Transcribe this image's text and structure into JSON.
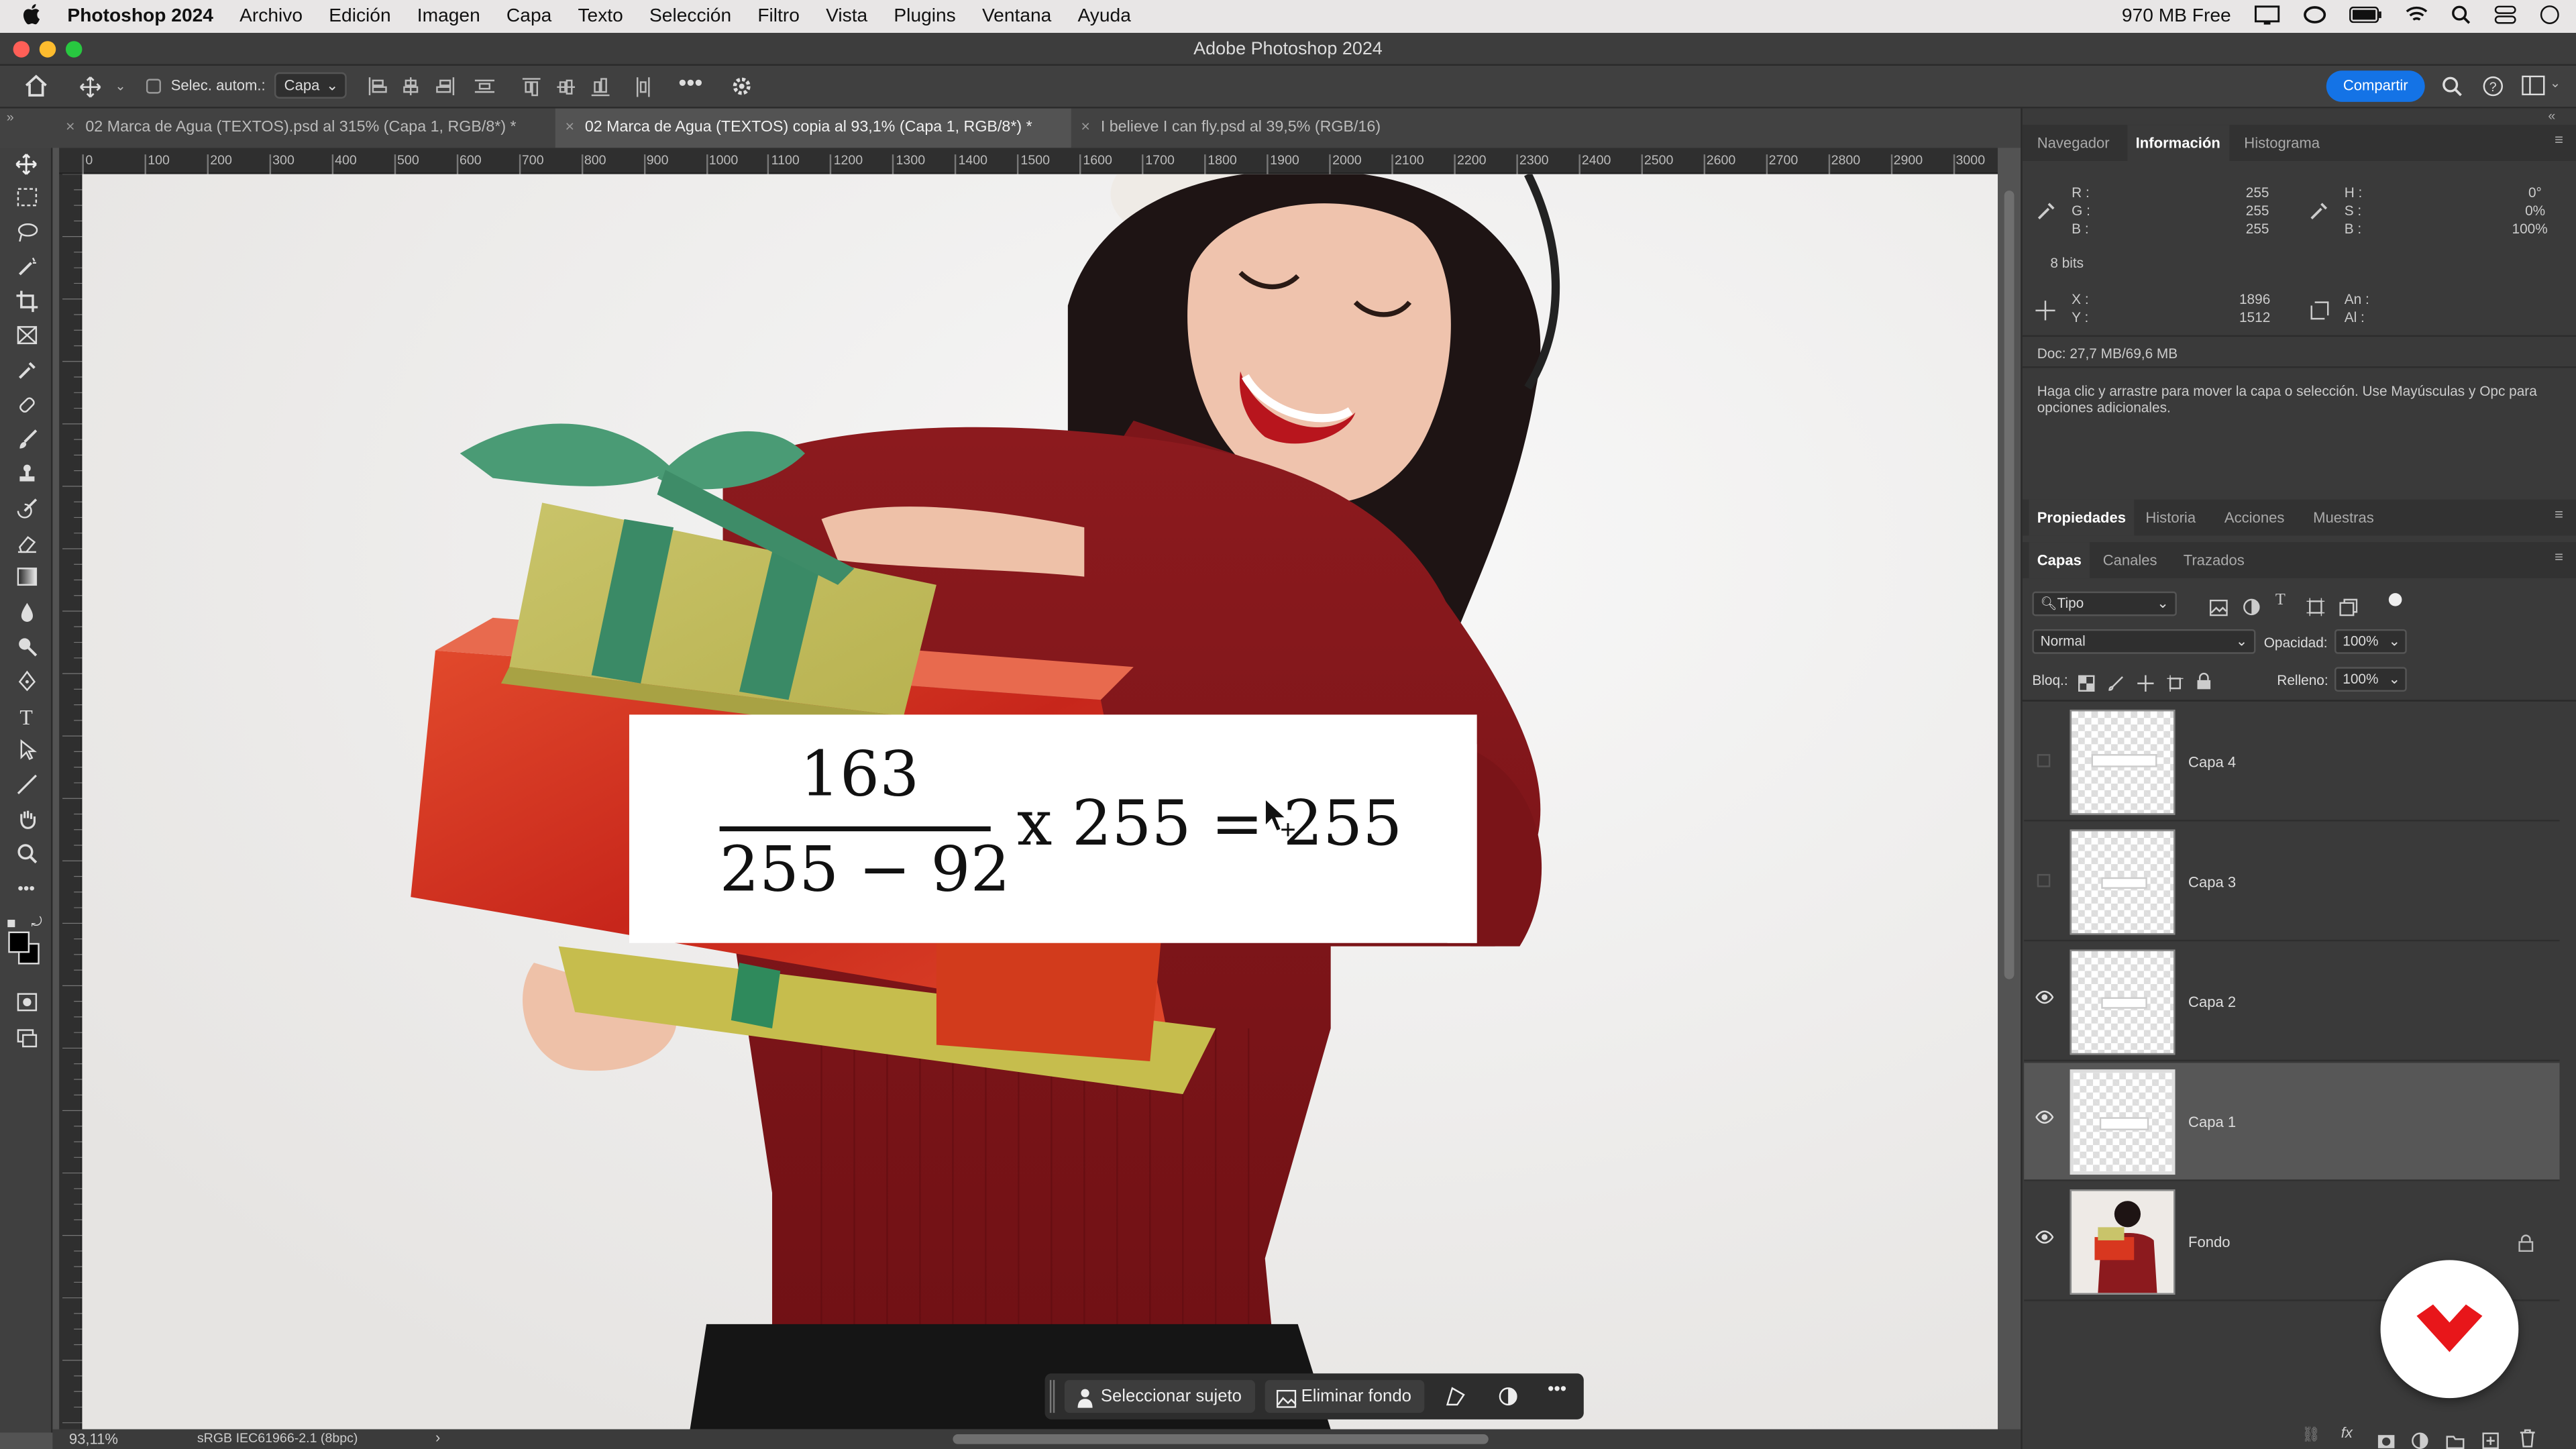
{
  "menubar": {
    "app": "Photoshop 2024",
    "items": [
      "Archivo",
      "Edición",
      "Imagen",
      "Capa",
      "Texto",
      "Selección",
      "Filtro",
      "Vista",
      "Plugins",
      "Ventana",
      "Ayuda"
    ],
    "memory": "970 MB Free"
  },
  "window": {
    "title": "Adobe Photoshop 2024"
  },
  "options": {
    "auto_select_label": "Selec. autom.:",
    "auto_select_value": "Capa",
    "share_button": "Compartir"
  },
  "tabs": [
    {
      "label": "02 Marca de Agua (TEXTOS).psd al 315% (Capa 1, RGB/8*) *"
    },
    {
      "label": "02 Marca de Agua (TEXTOS) copia al 93,1% (Capa 1, RGB/8*) *"
    },
    {
      "label": "I believe I can fly.psd al 39,5% (RGB/16)"
    }
  ],
  "ruler": {
    "ticks": [
      "0",
      "100",
      "200",
      "300",
      "400",
      "500",
      "600",
      "700",
      "800",
      "900",
      "1000",
      "1100",
      "1200",
      "1300",
      "1400",
      "1500",
      "1600",
      "1700",
      "1800",
      "1900",
      "2000",
      "2100",
      "2200",
      "2300",
      "2400",
      "2500",
      "2600",
      "2700",
      "2800",
      "2900",
      "3000"
    ]
  },
  "canvas": {
    "formula": {
      "numerator": "163",
      "denominator": "255 − 92",
      "rest": "x 255 = 255"
    }
  },
  "status": {
    "zoom": "93,11%",
    "profile": "sRGB IEC61966-2.1 (8bpc)",
    "arrow": "›"
  },
  "context_bar": {
    "select_subject": "Seleccionar sujeto",
    "remove_bg": "Eliminar fondo"
  },
  "panel_top": {
    "tabs": [
      "Navegador",
      "Información",
      "Histograma"
    ],
    "rgb": {
      "r_label": "R :",
      "g_label": "G :",
      "b_label": "B :",
      "r": "255",
      "g": "255",
      "b": "255"
    },
    "hsb": {
      "h_label": "H :",
      "s_label": "S :",
      "b_label": "B :",
      "h": "0°",
      "s": "0%",
      "b": "100%"
    },
    "bits": "8 bits",
    "xy": {
      "x_label": "X :",
      "y_label": "Y :",
      "x": "1896",
      "y": "1512"
    },
    "wh": {
      "w_label": "An :",
      "h_label": "Al :"
    },
    "doc": "Doc: 27,7 MB/69,6 MB",
    "hint": "Haga clic y arrastre para mover la capa o selección. Use Mayúsculas y Opc para opciones adicionales."
  },
  "panel_mid": {
    "tabs": [
      "Propiedades",
      "Historia",
      "Acciones",
      "Muestras"
    ]
  },
  "panel_layers": {
    "tabs": [
      "Capas",
      "Canales",
      "Trazados"
    ],
    "filter": "Tipo",
    "blend_mode": "Normal",
    "opacity_label": "Opacidad:",
    "opacity": "100%",
    "lock_label": "Bloq.:",
    "fill_label": "Relleno:",
    "fill": "100%",
    "layers": [
      {
        "name": "Capa 4",
        "visible": false,
        "selected": false
      },
      {
        "name": "Capa 3",
        "visible": false,
        "selected": false
      },
      {
        "name": "Capa 2",
        "visible": true,
        "selected": false
      },
      {
        "name": "Capa 1",
        "visible": true,
        "selected": true
      },
      {
        "name": "Fondo",
        "visible": true,
        "selected": false,
        "locked": true
      }
    ]
  },
  "colors": {
    "accent": "#1473e6",
    "brand_red": "#e8161a"
  }
}
